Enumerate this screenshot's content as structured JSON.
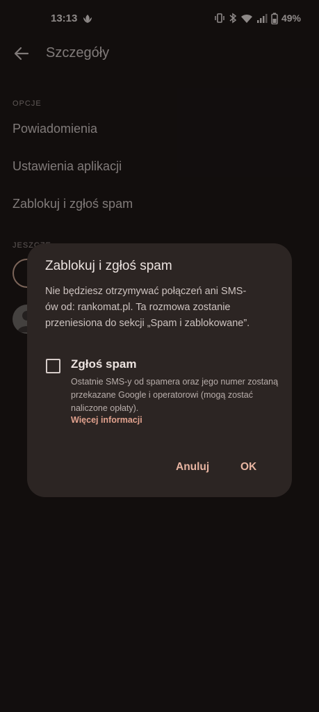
{
  "status_bar": {
    "time": "13:13",
    "battery_percent": "49%"
  },
  "app_bar": {
    "title": "Szczegóły"
  },
  "options_section": {
    "label": "OPCJE",
    "items": [
      {
        "label": "Powiadomienia"
      },
      {
        "label": "Ustawienia aplikacji"
      },
      {
        "label": "Zablokuj i zgłoś spam"
      }
    ]
  },
  "second_section": {
    "label": "JESZCZE"
  },
  "dialog": {
    "title": "Zablokuj i zgłoś spam",
    "body": "Nie będziesz otrzymywać połączeń ani SMS-ów od: rankomat.pl. Ta rozmowa zostanie przeniesiona do sekcji „Spam i zablokowane”.",
    "checkbox": {
      "label": "Zgłoś spam",
      "checked": false,
      "description": "Ostatnie SMS-y od spamera oraz jego numer zostaną przekazane Google i operatorowi (mogą zostać naliczone opłaty).",
      "link": "Więcej informacji"
    },
    "cancel_label": "Anuluj",
    "ok_label": "OK"
  },
  "colors": {
    "background": "#1d1716",
    "dialog": "#2c2523",
    "accent": "#e8b5a2"
  }
}
